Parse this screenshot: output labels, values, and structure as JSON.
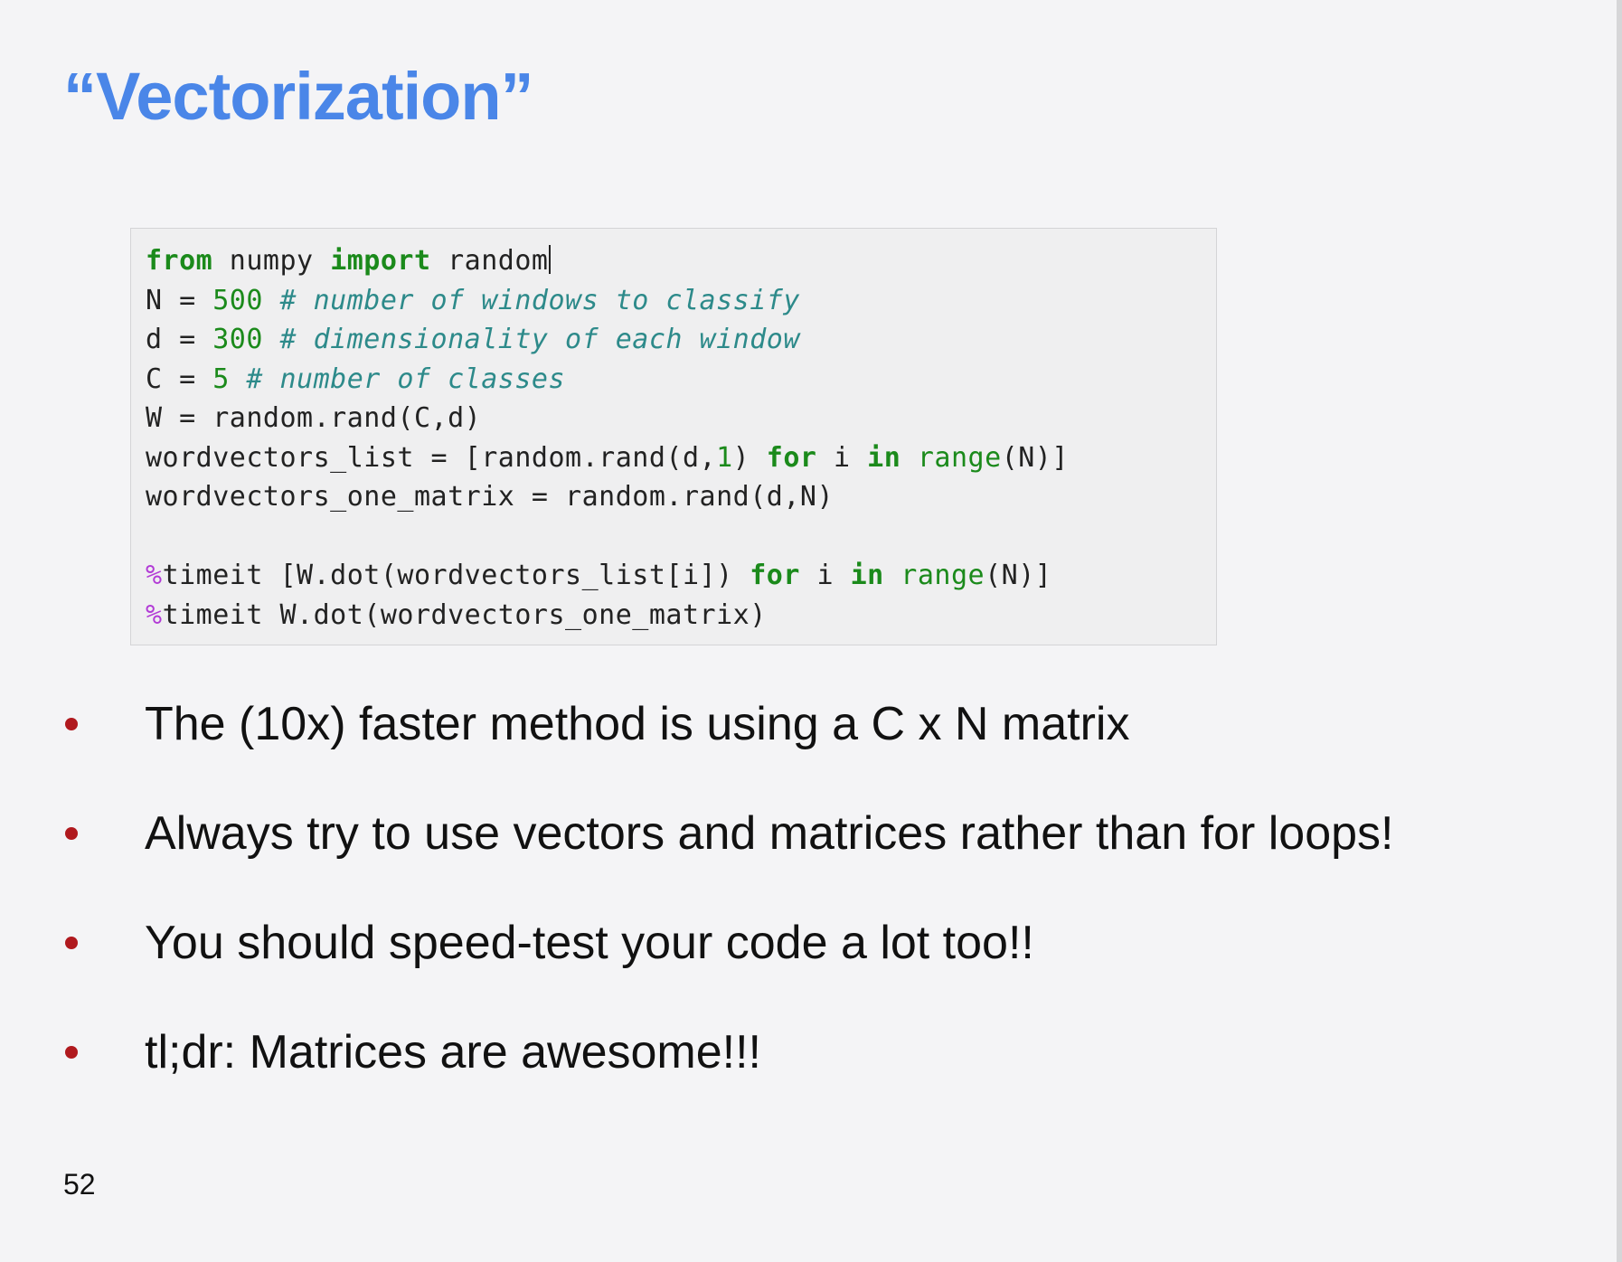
{
  "slide": {
    "title": "“Vectorization”",
    "page_number": "52"
  },
  "code": {
    "lines": [
      [
        {
          "t": "from",
          "c": "kw"
        },
        {
          "t": " numpy ",
          "c": ""
        },
        {
          "t": "import",
          "c": "kw"
        },
        {
          "t": " random",
          "c": ""
        }
      ],
      [
        {
          "t": "N = ",
          "c": ""
        },
        {
          "t": "500",
          "c": "num"
        },
        {
          "t": " ",
          "c": ""
        },
        {
          "t": "# number of windows to classify",
          "c": "cm"
        }
      ],
      [
        {
          "t": "d = ",
          "c": ""
        },
        {
          "t": "300",
          "c": "num"
        },
        {
          "t": " ",
          "c": ""
        },
        {
          "t": "# dimensionality of each window",
          "c": "cm"
        }
      ],
      [
        {
          "t": "C = ",
          "c": ""
        },
        {
          "t": "5",
          "c": "num"
        },
        {
          "t": " ",
          "c": ""
        },
        {
          "t": "# number of classes",
          "c": "cm"
        }
      ],
      [
        {
          "t": "W = random.rand(C,d)",
          "c": ""
        }
      ],
      [
        {
          "t": "wordvectors_list = [random.rand(d,",
          "c": ""
        },
        {
          "t": "1",
          "c": "num"
        },
        {
          "t": ") ",
          "c": ""
        },
        {
          "t": "for",
          "c": "kw"
        },
        {
          "t": " i ",
          "c": ""
        },
        {
          "t": "in",
          "c": "kw"
        },
        {
          "t": " ",
          "c": ""
        },
        {
          "t": "range",
          "c": "fn"
        },
        {
          "t": "(N)]",
          "c": ""
        }
      ],
      [
        {
          "t": "wordvectors_one_matrix = random.rand(d,N)",
          "c": ""
        }
      ],
      [],
      [
        {
          "t": "%",
          "c": "mg"
        },
        {
          "t": "timeit [W.dot(wordvectors_list[i]) ",
          "c": ""
        },
        {
          "t": "for",
          "c": "kw"
        },
        {
          "t": " i ",
          "c": ""
        },
        {
          "t": "in",
          "c": "kw"
        },
        {
          "t": " ",
          "c": ""
        },
        {
          "t": "range",
          "c": "fn"
        },
        {
          "t": "(N)]",
          "c": ""
        }
      ],
      [
        {
          "t": "%",
          "c": "mg"
        },
        {
          "t": "timeit W.dot(wordvectors_one_matrix)",
          "c": ""
        }
      ]
    ]
  },
  "bullets": [
    "The (10x) faster method is using a C x N matrix",
    "Always try to use vectors and matrices rather than for loops!",
    "You should speed-test your code a lot too!!",
    "tl;dr: Matrices are awesome!!!"
  ],
  "colors": {
    "title": "#4a86e8",
    "bullet_dot": "#b0191e",
    "keyword": "#1b8a1b",
    "comment": "#2d8a8a",
    "magic": "#b23bd6"
  }
}
